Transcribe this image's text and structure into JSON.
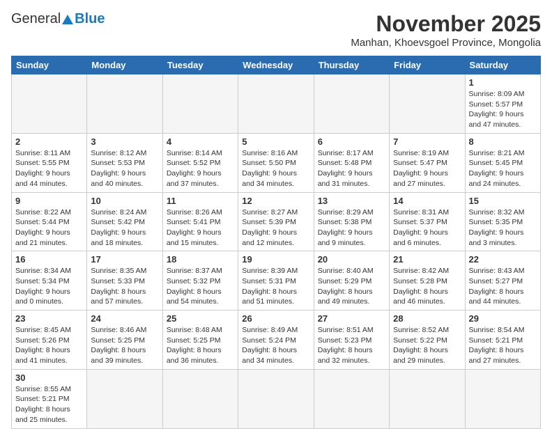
{
  "logo": {
    "text_general": "General",
    "text_blue": "Blue"
  },
  "title": "November 2025",
  "location": "Manhan, Khoevsgoel Province, Mongolia",
  "weekdays": [
    "Sunday",
    "Monday",
    "Tuesday",
    "Wednesday",
    "Thursday",
    "Friday",
    "Saturday"
  ],
  "weeks": [
    [
      {
        "day": null,
        "info": null
      },
      {
        "day": null,
        "info": null
      },
      {
        "day": null,
        "info": null
      },
      {
        "day": null,
        "info": null
      },
      {
        "day": null,
        "info": null
      },
      {
        "day": null,
        "info": null
      },
      {
        "day": "1",
        "info": "Sunrise: 8:09 AM\nSunset: 5:57 PM\nDaylight: 9 hours and 47 minutes."
      }
    ],
    [
      {
        "day": "2",
        "info": "Sunrise: 8:11 AM\nSunset: 5:55 PM\nDaylight: 9 hours and 44 minutes."
      },
      {
        "day": "3",
        "info": "Sunrise: 8:12 AM\nSunset: 5:53 PM\nDaylight: 9 hours and 40 minutes."
      },
      {
        "day": "4",
        "info": "Sunrise: 8:14 AM\nSunset: 5:52 PM\nDaylight: 9 hours and 37 minutes."
      },
      {
        "day": "5",
        "info": "Sunrise: 8:16 AM\nSunset: 5:50 PM\nDaylight: 9 hours and 34 minutes."
      },
      {
        "day": "6",
        "info": "Sunrise: 8:17 AM\nSunset: 5:48 PM\nDaylight: 9 hours and 31 minutes."
      },
      {
        "day": "7",
        "info": "Sunrise: 8:19 AM\nSunset: 5:47 PM\nDaylight: 9 hours and 27 minutes."
      },
      {
        "day": "8",
        "info": "Sunrise: 8:21 AM\nSunset: 5:45 PM\nDaylight: 9 hours and 24 minutes."
      }
    ],
    [
      {
        "day": "9",
        "info": "Sunrise: 8:22 AM\nSunset: 5:44 PM\nDaylight: 9 hours and 21 minutes."
      },
      {
        "day": "10",
        "info": "Sunrise: 8:24 AM\nSunset: 5:42 PM\nDaylight: 9 hours and 18 minutes."
      },
      {
        "day": "11",
        "info": "Sunrise: 8:26 AM\nSunset: 5:41 PM\nDaylight: 9 hours and 15 minutes."
      },
      {
        "day": "12",
        "info": "Sunrise: 8:27 AM\nSunset: 5:39 PM\nDaylight: 9 hours and 12 minutes."
      },
      {
        "day": "13",
        "info": "Sunrise: 8:29 AM\nSunset: 5:38 PM\nDaylight: 9 hours and 9 minutes."
      },
      {
        "day": "14",
        "info": "Sunrise: 8:31 AM\nSunset: 5:37 PM\nDaylight: 9 hours and 6 minutes."
      },
      {
        "day": "15",
        "info": "Sunrise: 8:32 AM\nSunset: 5:35 PM\nDaylight: 9 hours and 3 minutes."
      }
    ],
    [
      {
        "day": "16",
        "info": "Sunrise: 8:34 AM\nSunset: 5:34 PM\nDaylight: 9 hours and 0 minutes."
      },
      {
        "day": "17",
        "info": "Sunrise: 8:35 AM\nSunset: 5:33 PM\nDaylight: 8 hours and 57 minutes."
      },
      {
        "day": "18",
        "info": "Sunrise: 8:37 AM\nSunset: 5:32 PM\nDaylight: 8 hours and 54 minutes."
      },
      {
        "day": "19",
        "info": "Sunrise: 8:39 AM\nSunset: 5:31 PM\nDaylight: 8 hours and 51 minutes."
      },
      {
        "day": "20",
        "info": "Sunrise: 8:40 AM\nSunset: 5:29 PM\nDaylight: 8 hours and 49 minutes."
      },
      {
        "day": "21",
        "info": "Sunrise: 8:42 AM\nSunset: 5:28 PM\nDaylight: 8 hours and 46 minutes."
      },
      {
        "day": "22",
        "info": "Sunrise: 8:43 AM\nSunset: 5:27 PM\nDaylight: 8 hours and 44 minutes."
      }
    ],
    [
      {
        "day": "23",
        "info": "Sunrise: 8:45 AM\nSunset: 5:26 PM\nDaylight: 8 hours and 41 minutes."
      },
      {
        "day": "24",
        "info": "Sunrise: 8:46 AM\nSunset: 5:25 PM\nDaylight: 8 hours and 39 minutes."
      },
      {
        "day": "25",
        "info": "Sunrise: 8:48 AM\nSunset: 5:25 PM\nDaylight: 8 hours and 36 minutes."
      },
      {
        "day": "26",
        "info": "Sunrise: 8:49 AM\nSunset: 5:24 PM\nDaylight: 8 hours and 34 minutes."
      },
      {
        "day": "27",
        "info": "Sunrise: 8:51 AM\nSunset: 5:23 PM\nDaylight: 8 hours and 32 minutes."
      },
      {
        "day": "28",
        "info": "Sunrise: 8:52 AM\nSunset: 5:22 PM\nDaylight: 8 hours and 29 minutes."
      },
      {
        "day": "29",
        "info": "Sunrise: 8:54 AM\nSunset: 5:21 PM\nDaylight: 8 hours and 27 minutes."
      }
    ],
    [
      {
        "day": "30",
        "info": "Sunrise: 8:55 AM\nSunset: 5:21 PM\nDaylight: 8 hours and 25 minutes."
      },
      {
        "day": null,
        "info": null
      },
      {
        "day": null,
        "info": null
      },
      {
        "day": null,
        "info": null
      },
      {
        "day": null,
        "info": null
      },
      {
        "day": null,
        "info": null
      },
      {
        "day": null,
        "info": null
      }
    ]
  ]
}
